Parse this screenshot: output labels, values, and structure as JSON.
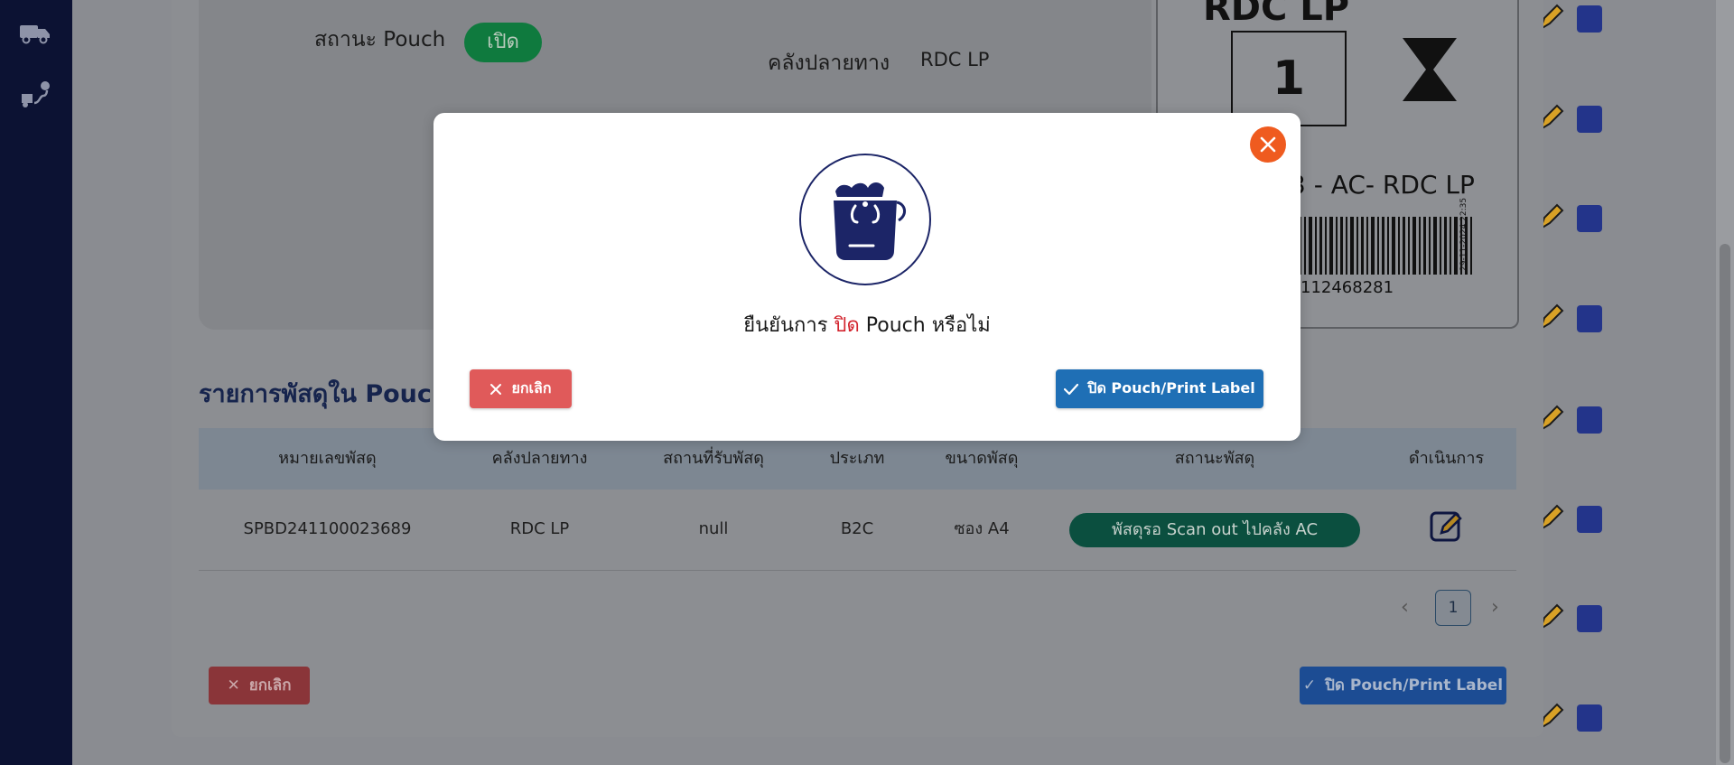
{
  "background": {
    "pouch_status_label": "สถานะ Pouch",
    "pouch_status_badge": "เปิด",
    "destination_label": "คลังปลายทาง",
    "destination_value": "RDC LP",
    "label_card": {
      "title": "RDC LP",
      "count": "1",
      "route": "3 - AC- RDC LP",
      "barcode_number": "112468281",
      "barcode_timestamp": "29-11-2024 22:35"
    },
    "section_title": "รายการพัสดุใน Pouch",
    "table": {
      "headers": [
        "หมายเลขพัสดุ",
        "คลังปลายทาง",
        "สถานที่รับพัสดุ",
        "ประเภท",
        "ขนาดพัสดุ",
        "สถานะพัสดุ",
        "ดำเนินการ"
      ],
      "rows": [
        {
          "parcel_no": "SPBD241100023689",
          "destination": "RDC LP",
          "pickup_location": "null",
          "type": "B2C",
          "size": "ซอง A4",
          "status": "พัสดุรอ Scan out ไปคลัง AC"
        }
      ]
    },
    "pagination": {
      "current_page": "1",
      "prev": "‹",
      "next": "›"
    },
    "cancel_button": "ยกเลิก",
    "close_print_button": "ปิด Pouch/Print Label"
  },
  "modal": {
    "icon": "pouch-bag-icon",
    "confirm_prefix": "ยืนยันการ ",
    "confirm_highlight": "ปิด",
    "confirm_suffix": " Pouch หรือไม่",
    "cancel_label": "ยกเลิก",
    "confirm_label": "ปิด Pouch/Print Label",
    "close_icon": "close-icon"
  },
  "colors": {
    "sidebar": "#0c1233",
    "close_accent": "#ef5b1f",
    "cancel": "#e05a5a",
    "confirm": "#1f6fb5",
    "brand_navy": "#1c2567",
    "highlight_red": "#d3252f",
    "status_green": "#0b4f3f"
  }
}
